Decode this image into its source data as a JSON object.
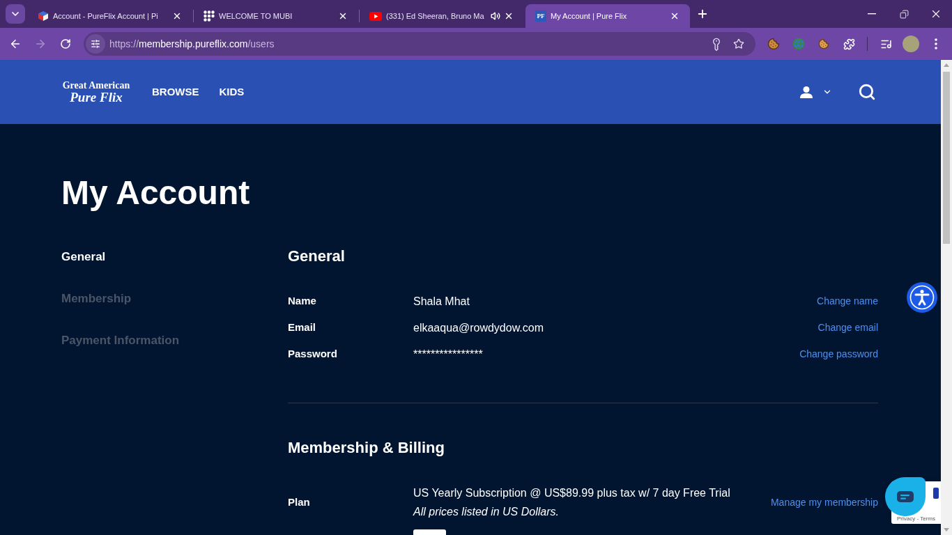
{
  "browser": {
    "tabs": [
      {
        "title": "Account - PureFlix Account | Pi",
        "selected": false,
        "audio_playing": false
      },
      {
        "title": "WELCOME TO MUBI",
        "selected": false,
        "audio_playing": false
      },
      {
        "title": "(331) Ed Sheeran, Bruno Ma",
        "selected": false,
        "audio_playing": true
      },
      {
        "title": "My Account | Pure Flix",
        "favicon_label": "PF",
        "selected": true,
        "audio_playing": false
      }
    ],
    "nav_buttons": [
      {
        "kind": "back",
        "disabled": false
      },
      {
        "kind": "forward",
        "disabled": true
      },
      {
        "kind": "reload",
        "disabled": false
      }
    ],
    "address": {
      "scheme": "https://",
      "host": "membership.pureflix.com",
      "path": "/users"
    }
  },
  "site_header": {
    "logo": {
      "line_1": "Great American",
      "line_2": "Pure Flix"
    },
    "nav": [
      "BROWSE",
      "KIDS"
    ]
  },
  "page_title": "My Account",
  "side_nav": [
    {
      "label": "General",
      "selected": true
    },
    {
      "label": "Membership",
      "selected": false
    },
    {
      "label": "Payment Information",
      "selected": false
    }
  ],
  "sections": [
    {
      "heading": "General",
      "rows": [
        {
          "label": "Name",
          "value": "Shala Mhat",
          "action": "Change name"
        },
        {
          "label": "Email",
          "value": "elkaaqua@rowdydow.com",
          "action": "Change email"
        },
        {
          "label": "Password",
          "value": "****************",
          "action": "Change password"
        }
      ]
    },
    {
      "heading": "Membership & Billing",
      "rows": [
        {
          "label": "Plan",
          "value": "US Yearly Subscription @ US$89.99 plus tax w/ 7 day Free Trial",
          "note": "All prices listed in US Dollars.",
          "action": "Manage my membership"
        }
      ]
    }
  ],
  "recaptcha": {
    "links": "Privacy - Terms"
  }
}
